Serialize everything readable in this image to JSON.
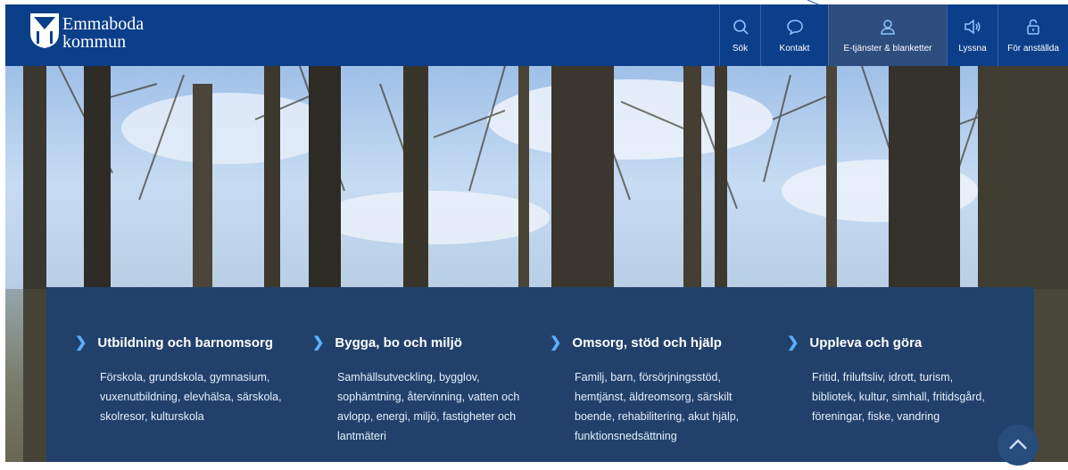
{
  "header": {
    "logo": {
      "line1": "Emmaboda",
      "line2": "kommun"
    },
    "nav": [
      {
        "label": "Sök",
        "icon": "search-icon"
      },
      {
        "label": "Kontakt",
        "icon": "chat-bubble-icon"
      },
      {
        "label": "E-tjänster & blanketter",
        "icon": "user-icon"
      },
      {
        "label": "Lyssna",
        "icon": "speaker-icon"
      },
      {
        "label": "För anställda",
        "icon": "lock-icon"
      }
    ]
  },
  "categories": [
    {
      "title": "Utbildning och barnomsorg",
      "lines": [
        "Förskola, grundskola, gymnasium,",
        "vuxenutbildning, elevhälsa, särskola,",
        "skolresor, kulturskola"
      ]
    },
    {
      "title": "Bygga, bo och miljö",
      "lines": [
        "Samhällsutveckling, bygglov,",
        "sophämtning, återvinning, vatten och",
        "avlopp, energi, miljö, fastigheter och",
        "lantmäteri"
      ]
    },
    {
      "title": "Omsorg, stöd och hjälp",
      "lines": [
        "Familj, barn, försörjningsstöd,",
        "hemtjänst, äldreomsorg, särskilt",
        "boende, rehabilitering, akut hjälp,",
        "funktionsnedsättning"
      ]
    },
    {
      "title": "Uppleva och göra",
      "lines": [
        "Fritid, friluftsliv, idrott, turism,",
        "bibliotek, kultur, simhall, fritidsgård,",
        "föreningar, fiske, vandring"
      ]
    }
  ],
  "colors": {
    "header": "#0b3f8a",
    "panel": "#21416b",
    "accent": "#5ab0ff"
  }
}
